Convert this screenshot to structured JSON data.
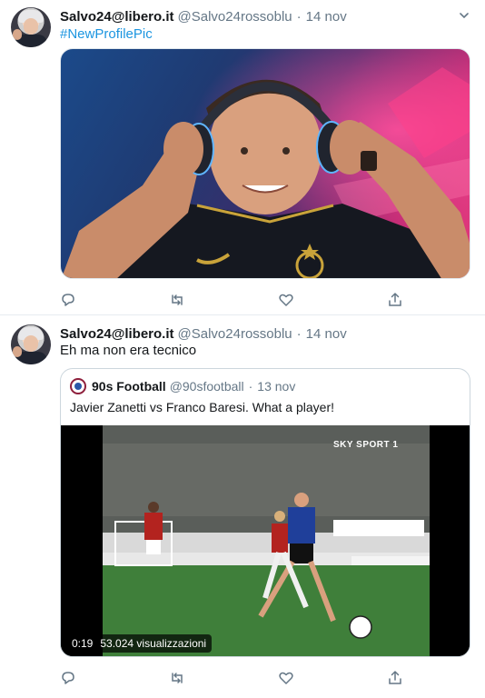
{
  "tweets": [
    {
      "author_name": "Salvo24@libero.it",
      "handle": "@Salvo24rossoblu",
      "separator": "·",
      "date": "14 nov",
      "text": "#NewProfilePic",
      "media": "photo"
    },
    {
      "author_name": "Salvo24@libero.it",
      "handle": "@Salvo24rossoblu",
      "separator": "·",
      "date": "14 nov",
      "text": "Eh ma non era tecnico",
      "quoted": {
        "author_name": "90s Football",
        "handle": "@90sfootball",
        "separator": "·",
        "date": "13 nov",
        "text": "Javier Zanetti vs Franco Baresi. What a player!",
        "video": {
          "duration": "0:19",
          "views": "53.024 visualizzazioni",
          "overlay_logo": "SKY SPORT 1"
        }
      }
    }
  ],
  "icons": {
    "reply": "reply-icon",
    "retweet": "retweet-icon",
    "like": "like-icon",
    "share": "share-icon",
    "more": "chevron-down-icon"
  },
  "colors": {
    "link": "#1b95e0",
    "secondary_text": "#657786",
    "border": "#e6ecf0"
  }
}
